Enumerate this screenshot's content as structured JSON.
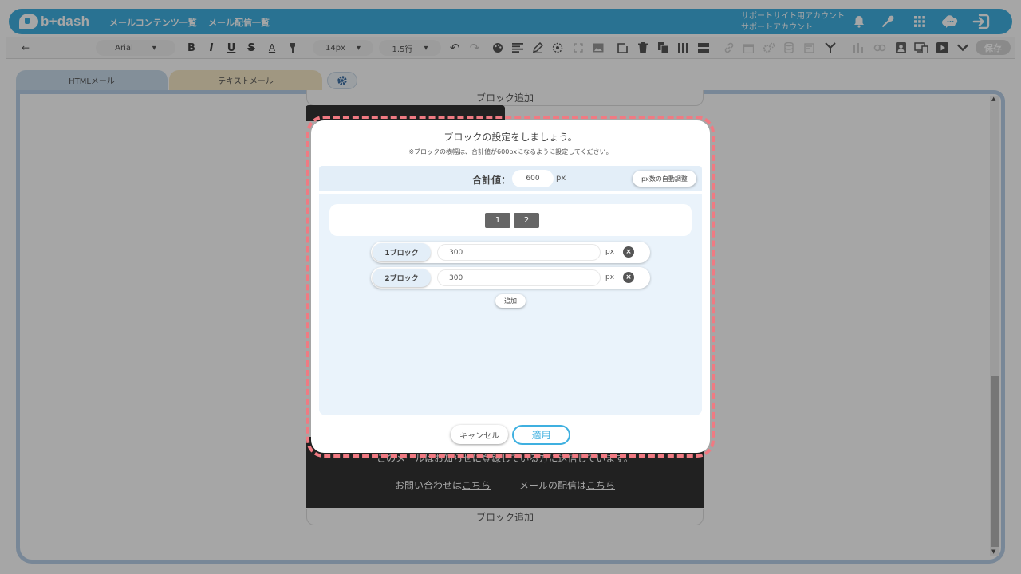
{
  "header": {
    "logo_text": "b+dash",
    "nav": [
      "メールコンテンツ一覧",
      "メール配信一覧"
    ],
    "account_line1": "サポートサイト用アカウント",
    "account_line2": "サポートアカウント",
    "icons": [
      "bell-icon",
      "wrench-icon",
      "grid-icon",
      "chat-cloud-icon",
      "logout-icon"
    ]
  },
  "toolbar": {
    "back": "←",
    "font": "Arial",
    "font_size": "14px",
    "line_height": "1.5行",
    "save_label": "保存",
    "bold": "B",
    "italic": "I",
    "underline": "U",
    "strike": "S",
    "font_color": "A"
  },
  "tabs": {
    "html": "HTMLメール",
    "text": "テキストメール"
  },
  "canvas": {
    "add_block_top": "ブロック追加",
    "add_block_bottom": "ブロック追加",
    "footer_line": "このメールはお知らせに登録している方に送信しています。",
    "contact_prefix": "お問い合わせは",
    "contact_link": "こちら",
    "delivery_prefix": "メールの配信は",
    "delivery_link": "こちら"
  },
  "modal": {
    "title": "ブロックの設定をしましょう。",
    "note": "※ブロックの横幅は、合計値が600pxになるように設定してください。",
    "total_label": "合計値：",
    "total_value": "600",
    "total_unit": "px",
    "auto_adjust_label": "px数の自動調整",
    "preview_blocks": [
      "1",
      "2"
    ],
    "rows": [
      {
        "label": "1ブロック",
        "value": "300",
        "unit": "px"
      },
      {
        "label": "2ブロック",
        "value": "300",
        "unit": "px"
      }
    ],
    "add_label": "追加",
    "cancel_label": "キャンセル",
    "apply_label": "適用"
  },
  "colors": {
    "brand": "#3fb0e0",
    "highlight_outline": "#f07a82",
    "html_tab": "#c9dcec",
    "text_tab": "#f6e8c6"
  }
}
